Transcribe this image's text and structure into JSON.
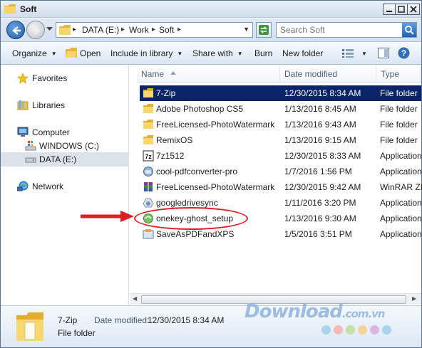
{
  "window": {
    "title": "Soft"
  },
  "address": {
    "crumbs": [
      "DATA (E:)",
      "Work",
      "Soft"
    ]
  },
  "search": {
    "placeholder": "Search Soft"
  },
  "commands": {
    "organize": "Organize",
    "open": "Open",
    "include_in_library": "Include in library",
    "share_with": "Share with",
    "burn": "Burn",
    "new_folder": "New folder"
  },
  "nav": {
    "favorites": "Favorites",
    "libraries": "Libraries",
    "computer": "Computer",
    "windows_drive": "WINDOWS (C:)",
    "data_drive": "DATA (E:)",
    "network": "Network"
  },
  "columns": {
    "name": "Name",
    "date": "Date modified",
    "type": "Type"
  },
  "files": [
    {
      "name": "7-Zip",
      "date": "12/30/2015 8:34 AM",
      "type": "File folder",
      "icon": "folder-icon",
      "selected": true
    },
    {
      "name": "Adobe Photoshop CS5",
      "date": "1/13/2016 8:45 AM",
      "type": "File folder",
      "icon": "folder-icon"
    },
    {
      "name": "FreeLicensed-PhotoWatermark",
      "date": "1/13/2016 9:43 AM",
      "type": "File folder",
      "icon": "folder-icon"
    },
    {
      "name": "RemixOS",
      "date": "1/13/2016 9:15 AM",
      "type": "File folder",
      "icon": "folder-icon"
    },
    {
      "name": "7z1512",
      "date": "12/30/2015 8:33 AM",
      "type": "Application",
      "icon": "7zip-app-icon"
    },
    {
      "name": "cool-pdfconverter-pro",
      "date": "1/7/2016 1:56 PM",
      "type": "Application",
      "icon": "installer-app-icon"
    },
    {
      "name": "FreeLicensed-PhotoWatermark",
      "date": "12/30/2015 9:42 AM",
      "type": "WinRAR ZIP",
      "icon": "winrar-archive-icon"
    },
    {
      "name": "googledrivesync",
      "date": "1/11/2016 3:20 PM",
      "type": "Application",
      "icon": "google-drive-icon"
    },
    {
      "name": "onekey-ghost_setup",
      "date": "1/13/2016 9:30 AM",
      "type": "Application",
      "icon": "onekey-ghost-icon"
    },
    {
      "name": "SaveAsPDFandXPS",
      "date": "1/5/2016 3:51 PM",
      "type": "Application",
      "icon": "office-installer-icon"
    }
  ],
  "details": {
    "name": "7-Zip",
    "date_label": "Date modified:",
    "date_value": "12/30/2015 8:34 AM",
    "type": "File folder"
  },
  "watermark": {
    "text": "Download",
    "suffix": ".com.vn"
  },
  "colors": {
    "selection": "#0a246a",
    "annotation_red": "#e01e24",
    "folder_yellow": "#f2c94c"
  }
}
